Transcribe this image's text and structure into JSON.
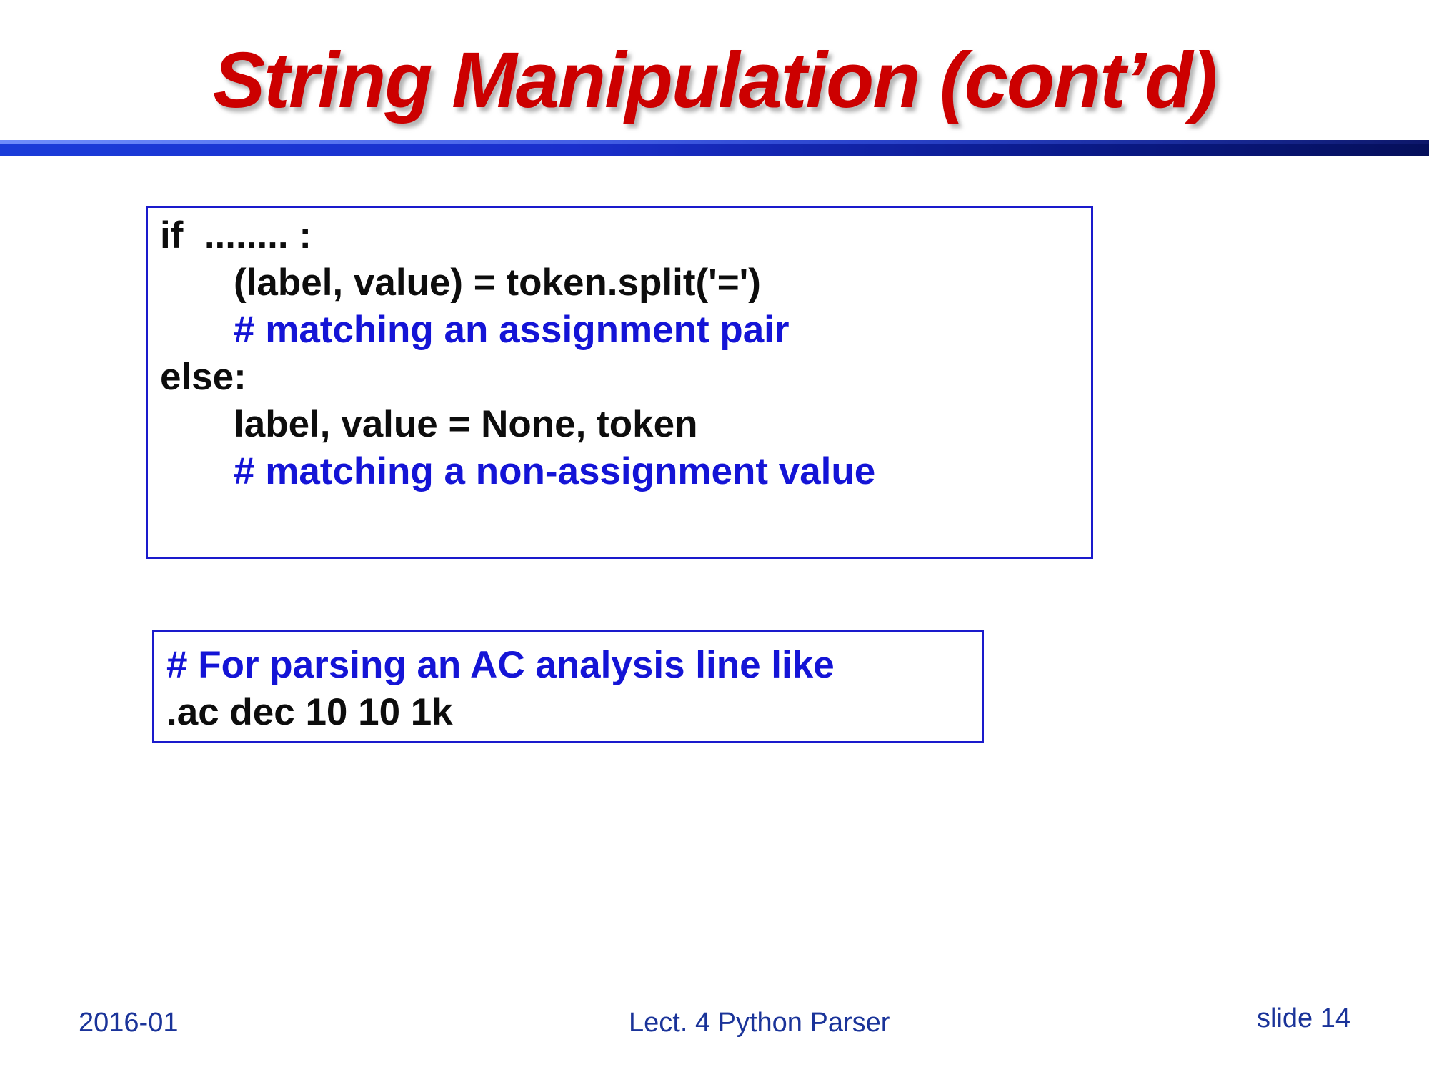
{
  "slide": {
    "title": "String Manipulation (cont’d)",
    "code_box": {
      "lines": [
        {
          "text": "if  ........ :",
          "kind": "code"
        },
        {
          "text": "(label, value) = token.split('=')",
          "kind": "code"
        },
        {
          "text": "# matching an assignment pair",
          "kind": "comment"
        },
        {
          "text": "else:",
          "kind": "code"
        },
        {
          "text": "label, value = None, token",
          "kind": "code"
        },
        {
          "text": "# matching a non-assignment value",
          "kind": "comment"
        }
      ]
    },
    "note_box": {
      "lines": [
        {
          "text": "# For parsing an AC analysis line like",
          "kind": "comment"
        },
        {
          "text": ".ac dec 10 10 1k",
          "kind": "code"
        }
      ]
    },
    "footer": {
      "date": "2016-01",
      "lecture": "Lect. 4 Python Parser",
      "slide_number": "slide 14"
    }
  },
  "colors": {
    "title": "#cc0000",
    "code_text": "#0d0d0d",
    "comment_text": "#1414d6",
    "box_border": "#1a1acc",
    "footer_text": "#1a3399",
    "title_bar": "#1a2fcc"
  }
}
